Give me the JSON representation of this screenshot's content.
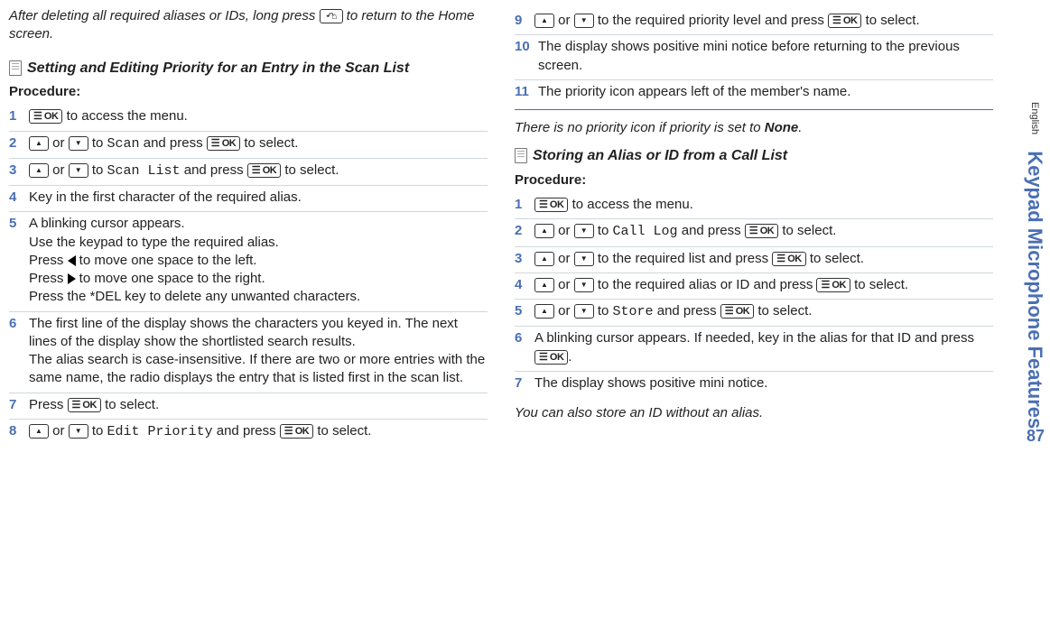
{
  "tab": {
    "english": "English",
    "title": "Keypad Microphone Features"
  },
  "pageNumber": "87",
  "left": {
    "intro_a": "After deleting all required aliases or IDs, long press ",
    "intro_b": " to return to the Home screen.",
    "section1": "Setting and Editing Priority for an Entry in the Scan List",
    "procedure": "Procedure:",
    "s1": " to access the menu.",
    "s2_a": " or ",
    "s2_b": " to ",
    "s2_target": "Scan",
    "s2_c": " and press ",
    "s2_d": " to select.",
    "s3_target": "Scan List",
    "s4": "Key in the first character of the required alias.",
    "s5_a": "A blinking cursor appears.",
    "s5_b": "Use the keypad to type the required alias.",
    "s5_c": "Press ",
    "s5_d": " to move one space to the left.",
    "s5_e": "Press ",
    "s5_f": " to move one space to the right.",
    "s5_g": "Press the *DEL key to delete any unwanted characters.",
    "s6_a": "The first line of the display shows the characters you keyed in. The next lines of the display show the shortlisted search results.",
    "s6_b": "The alias search is case-insensitive. If there are two or more entries with the same name, the radio displays the entry that is listed first in the scan list.",
    "s7_a": "Press ",
    "s7_b": " to select.",
    "s8_target": "Edit Priority"
  },
  "right": {
    "s9": " to the required priority level and press ",
    "s9_b": " to select.",
    "s10": "The display shows positive mini notice before returning to the previous screen.",
    "s11": "The priority icon appears left of the member's name.",
    "note1_a": "There is no priority icon if priority is set to ",
    "note1_b": "None",
    "note1_c": ".",
    "section2": "Storing an Alias or ID from a Call List",
    "procedure": "Procedure:",
    "s1": " to access the menu.",
    "s2_target": "Call Log",
    "s3": " to the required list and press ",
    "s4": " to the required alias or ID and press ",
    "s4_b": " to select.",
    "s5_target": "Store",
    "s5_b": " and press ",
    "s5_c": " to select.",
    "s6_a": "A blinking cursor appears. If needed, key in the alias for that ID and press ",
    "s6_b": ".",
    "s7": "The display shows positive mini notice.",
    "note2": "You can also store an ID without an alias."
  },
  "common": {
    "or": " or ",
    "to": " to ",
    "andpress": " and press ",
    "toselect": " to select."
  }
}
